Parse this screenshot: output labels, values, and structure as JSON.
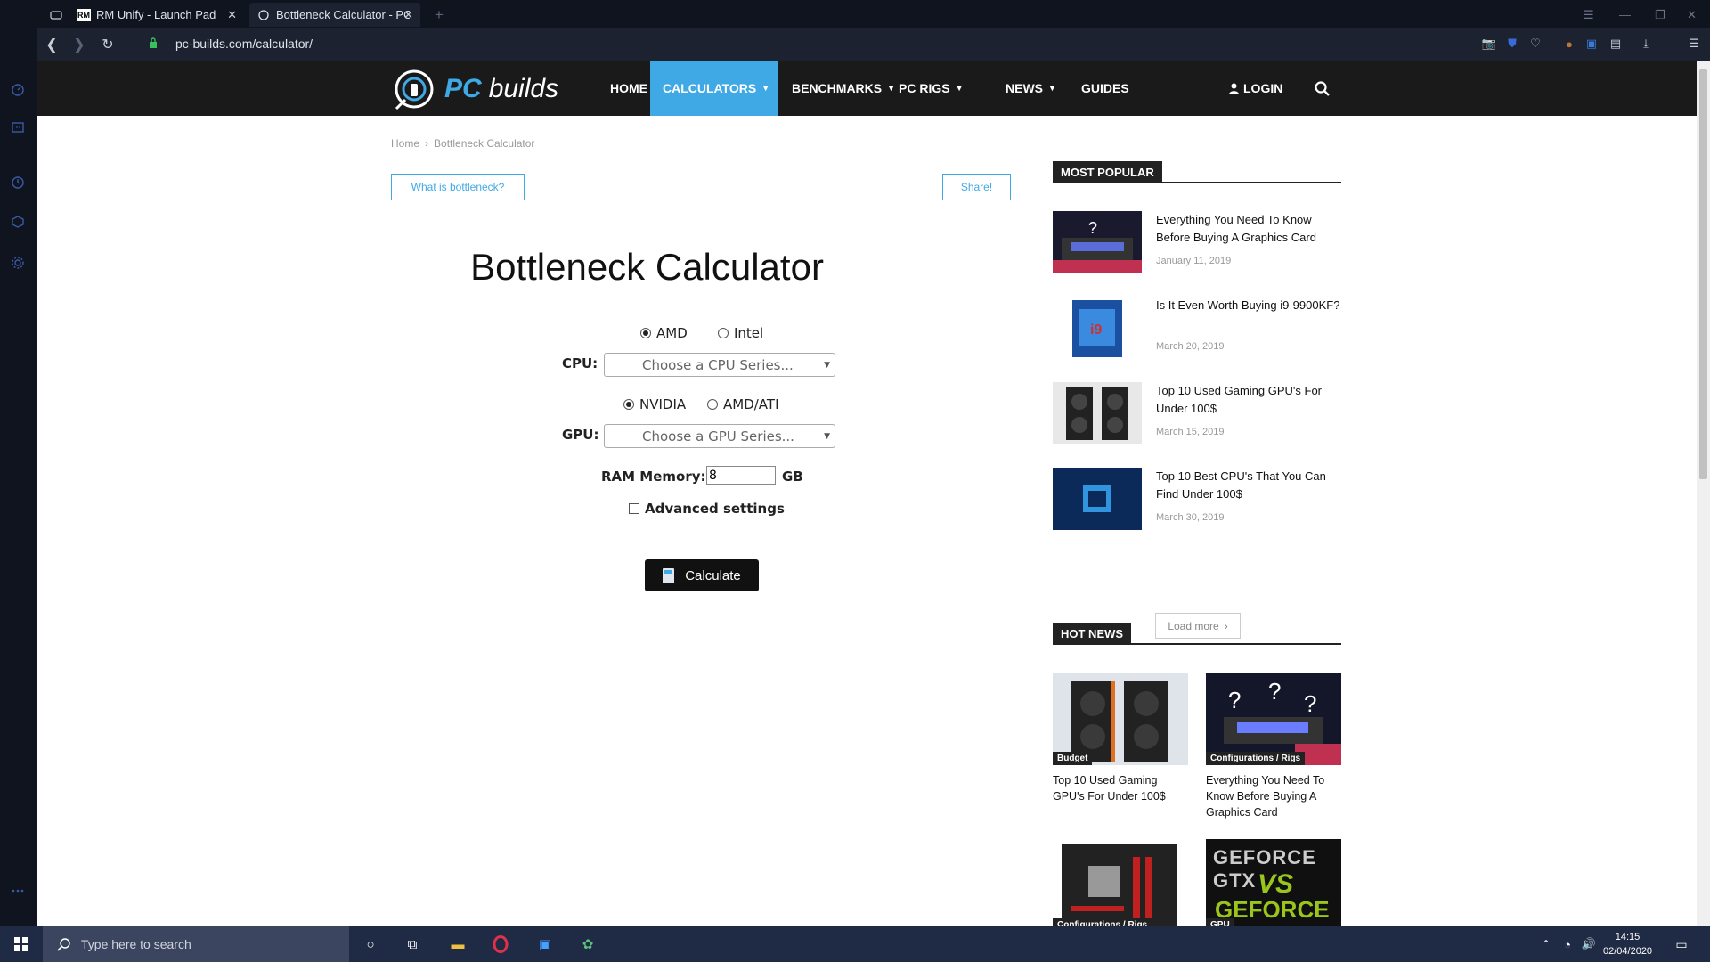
{
  "browser": {
    "tabs": [
      {
        "favicon": "RM",
        "title": "RM Unify - Launch Pad"
      },
      {
        "favicon": "pc",
        "title": "Bottleneck Calculator - PC"
      }
    ],
    "new_tab": "+",
    "url": "pc-builds.com/calculator/"
  },
  "site": {
    "logo_pc": "PC",
    "logo_builds": "builds",
    "nav": [
      "HOME",
      "CALCULATORS",
      "BENCHMARKS",
      "PC RIGS",
      "NEWS",
      "GUIDES"
    ],
    "login": "LOGIN"
  },
  "breadcrumb": {
    "home": "Home",
    "current": "Bottleneck Calculator"
  },
  "buttons": {
    "what_is": "What is bottleneck?",
    "share": "Share!"
  },
  "calculator": {
    "title": "Bottleneck Calculator",
    "cpu_brands": [
      "AMD",
      "Intel"
    ],
    "cpu_label": "CPU:",
    "cpu_placeholder": "Choose a CPU Series...",
    "gpu_brands": [
      "NVIDIA",
      "AMD/ATI"
    ],
    "gpu_label": "GPU:",
    "gpu_placeholder": "Choose a GPU Series...",
    "ram_label": "RAM Memory:",
    "ram_value": "8",
    "ram_unit": "GB",
    "advanced": "Advanced settings",
    "calculate": "Calculate"
  },
  "most_popular": {
    "heading": "MOST POPULAR",
    "items": [
      {
        "title": "Everything You Need To Know Before Buying A Graphics Card",
        "date": "January 11, 2019"
      },
      {
        "title": "Is It Even Worth Buying i9-9900KF?",
        "date": "March 20, 2019"
      },
      {
        "title": "Top 10 Used Gaming GPU's For Under 100$",
        "date": "March 15, 2019"
      },
      {
        "title": "Top 10 Best CPU's That You Can Find Under 100$",
        "date": "March 30, 2019"
      }
    ],
    "load_more": "Load more"
  },
  "hot_news": {
    "heading": "HOT NEWS",
    "items": [
      {
        "category": "Budget",
        "title": "Top 10 Used Gaming GPU's For Under 100$"
      },
      {
        "category": "Configurations / Rigs",
        "title": "Everything You Need To Know Before Buying A Graphics Card"
      },
      {
        "category": "Configurations / Rigs",
        "title": ""
      },
      {
        "category": "GPU",
        "title": ""
      }
    ],
    "thumb_text_top": "GEFORCE GTX",
    "thumb_text_mid": "VS",
    "thumb_text_bottom": "GEFORCE RTX"
  },
  "taskbar": {
    "search_placeholder": "Type here to search",
    "time": "14:15",
    "date": "02/04/2020"
  },
  "colors": {
    "accent": "#3fa9e6",
    "nav_bg": "#1a1a1a",
    "taskbar": "#1f2a44"
  }
}
